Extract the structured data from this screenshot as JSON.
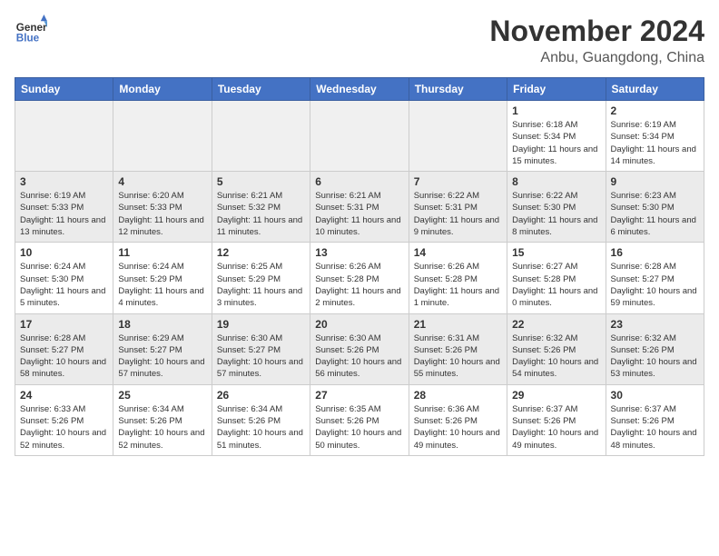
{
  "header": {
    "logo_line1": "General",
    "logo_line2": "Blue",
    "title": "November 2024",
    "subtitle": "Anbu, Guangdong, China"
  },
  "days_of_week": [
    "Sunday",
    "Monday",
    "Tuesday",
    "Wednesday",
    "Thursday",
    "Friday",
    "Saturday"
  ],
  "weeks": [
    {
      "shaded": false,
      "days": [
        {
          "num": "",
          "info": ""
        },
        {
          "num": "",
          "info": ""
        },
        {
          "num": "",
          "info": ""
        },
        {
          "num": "",
          "info": ""
        },
        {
          "num": "",
          "info": ""
        },
        {
          "num": "1",
          "info": "Sunrise: 6:18 AM\nSunset: 5:34 PM\nDaylight: 11 hours and 15 minutes."
        },
        {
          "num": "2",
          "info": "Sunrise: 6:19 AM\nSunset: 5:34 PM\nDaylight: 11 hours and 14 minutes."
        }
      ]
    },
    {
      "shaded": true,
      "days": [
        {
          "num": "3",
          "info": "Sunrise: 6:19 AM\nSunset: 5:33 PM\nDaylight: 11 hours and 13 minutes."
        },
        {
          "num": "4",
          "info": "Sunrise: 6:20 AM\nSunset: 5:33 PM\nDaylight: 11 hours and 12 minutes."
        },
        {
          "num": "5",
          "info": "Sunrise: 6:21 AM\nSunset: 5:32 PM\nDaylight: 11 hours and 11 minutes."
        },
        {
          "num": "6",
          "info": "Sunrise: 6:21 AM\nSunset: 5:31 PM\nDaylight: 11 hours and 10 minutes."
        },
        {
          "num": "7",
          "info": "Sunrise: 6:22 AM\nSunset: 5:31 PM\nDaylight: 11 hours and 9 minutes."
        },
        {
          "num": "8",
          "info": "Sunrise: 6:22 AM\nSunset: 5:30 PM\nDaylight: 11 hours and 8 minutes."
        },
        {
          "num": "9",
          "info": "Sunrise: 6:23 AM\nSunset: 5:30 PM\nDaylight: 11 hours and 6 minutes."
        }
      ]
    },
    {
      "shaded": false,
      "days": [
        {
          "num": "10",
          "info": "Sunrise: 6:24 AM\nSunset: 5:30 PM\nDaylight: 11 hours and 5 minutes."
        },
        {
          "num": "11",
          "info": "Sunrise: 6:24 AM\nSunset: 5:29 PM\nDaylight: 11 hours and 4 minutes."
        },
        {
          "num": "12",
          "info": "Sunrise: 6:25 AM\nSunset: 5:29 PM\nDaylight: 11 hours and 3 minutes."
        },
        {
          "num": "13",
          "info": "Sunrise: 6:26 AM\nSunset: 5:28 PM\nDaylight: 11 hours and 2 minutes."
        },
        {
          "num": "14",
          "info": "Sunrise: 6:26 AM\nSunset: 5:28 PM\nDaylight: 11 hours and 1 minute."
        },
        {
          "num": "15",
          "info": "Sunrise: 6:27 AM\nSunset: 5:28 PM\nDaylight: 11 hours and 0 minutes."
        },
        {
          "num": "16",
          "info": "Sunrise: 6:28 AM\nSunset: 5:27 PM\nDaylight: 10 hours and 59 minutes."
        }
      ]
    },
    {
      "shaded": true,
      "days": [
        {
          "num": "17",
          "info": "Sunrise: 6:28 AM\nSunset: 5:27 PM\nDaylight: 10 hours and 58 minutes."
        },
        {
          "num": "18",
          "info": "Sunrise: 6:29 AM\nSunset: 5:27 PM\nDaylight: 10 hours and 57 minutes."
        },
        {
          "num": "19",
          "info": "Sunrise: 6:30 AM\nSunset: 5:27 PM\nDaylight: 10 hours and 57 minutes."
        },
        {
          "num": "20",
          "info": "Sunrise: 6:30 AM\nSunset: 5:26 PM\nDaylight: 10 hours and 56 minutes."
        },
        {
          "num": "21",
          "info": "Sunrise: 6:31 AM\nSunset: 5:26 PM\nDaylight: 10 hours and 55 minutes."
        },
        {
          "num": "22",
          "info": "Sunrise: 6:32 AM\nSunset: 5:26 PM\nDaylight: 10 hours and 54 minutes."
        },
        {
          "num": "23",
          "info": "Sunrise: 6:32 AM\nSunset: 5:26 PM\nDaylight: 10 hours and 53 minutes."
        }
      ]
    },
    {
      "shaded": false,
      "days": [
        {
          "num": "24",
          "info": "Sunrise: 6:33 AM\nSunset: 5:26 PM\nDaylight: 10 hours and 52 minutes."
        },
        {
          "num": "25",
          "info": "Sunrise: 6:34 AM\nSunset: 5:26 PM\nDaylight: 10 hours and 52 minutes."
        },
        {
          "num": "26",
          "info": "Sunrise: 6:34 AM\nSunset: 5:26 PM\nDaylight: 10 hours and 51 minutes."
        },
        {
          "num": "27",
          "info": "Sunrise: 6:35 AM\nSunset: 5:26 PM\nDaylight: 10 hours and 50 minutes."
        },
        {
          "num": "28",
          "info": "Sunrise: 6:36 AM\nSunset: 5:26 PM\nDaylight: 10 hours and 49 minutes."
        },
        {
          "num": "29",
          "info": "Sunrise: 6:37 AM\nSunset: 5:26 PM\nDaylight: 10 hours and 49 minutes."
        },
        {
          "num": "30",
          "info": "Sunrise: 6:37 AM\nSunset: 5:26 PM\nDaylight: 10 hours and 48 minutes."
        }
      ]
    }
  ]
}
